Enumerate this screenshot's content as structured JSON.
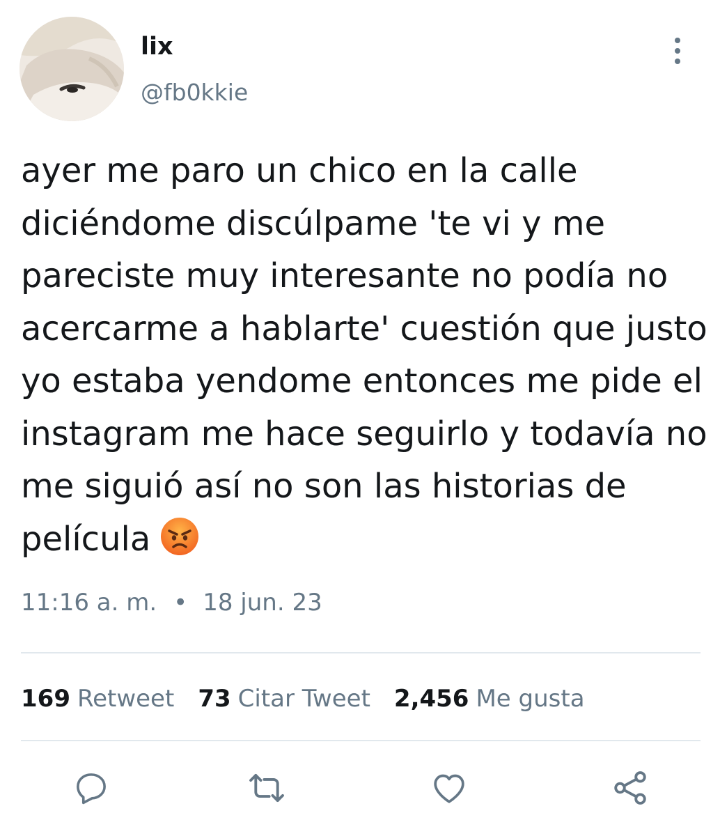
{
  "author": {
    "display_name": "lix",
    "handle": "@fb0kkie",
    "avatar_icon": "avatar"
  },
  "more_icon": "more-vertical-icon",
  "tweet": {
    "lines": [
      "ayer me paro un chico en la calle",
      "diciéndome discúlpame 'te vi y me",
      "pareciste muy interesante no podía no",
      "acercarme a hablarte' cuestión que justo",
      "yo estaba yendome entonces me pide el",
      "instagram me hace seguirlo y todavía no",
      "me siguió así no son las historias de",
      "película"
    ],
    "emoji": "angry-face-emoji"
  },
  "meta": {
    "time": "11:16 a. m.",
    "separator": "•",
    "date": "18 jun. 23"
  },
  "stats": {
    "retweets_count": "169",
    "retweets_label": "Retweet",
    "quotes_count": "73",
    "quotes_label": "Citar Tweet",
    "likes_count": "2,456",
    "likes_label": "Me gusta"
  },
  "actions": {
    "reply_icon": "reply-icon",
    "retweet_icon": "retweet-icon",
    "like_icon": "heart-icon",
    "share_icon": "share-icon"
  },
  "colors": {
    "text_primary": "#14171a",
    "text_secondary": "#657786",
    "divider": "#e1e8ed",
    "icon": "#657786"
  }
}
